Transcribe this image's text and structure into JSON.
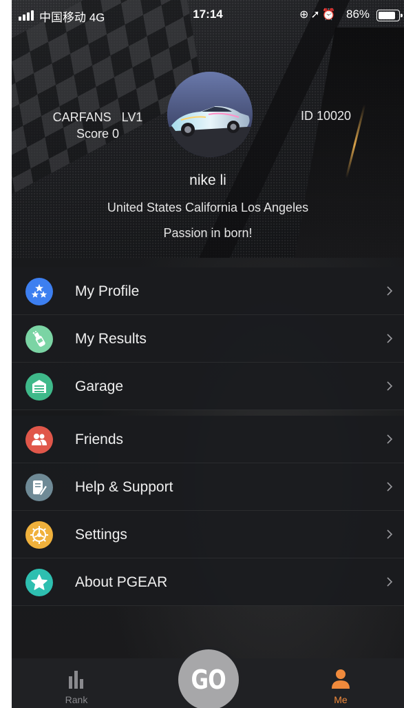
{
  "status_bar": {
    "carrier": "中国移动 4G",
    "time": "17:14",
    "battery_pct": "86%",
    "battery_level": 0.86,
    "icons": [
      "orientation-lock-icon",
      "location-arrow-icon",
      "alarm-icon"
    ]
  },
  "profile": {
    "level_text": "CARFANS   LV1",
    "score_text": "Score 0",
    "id_text": "ID 10020",
    "name": "nike li",
    "location": "United States California Los Angeles",
    "motto": "Passion in born!"
  },
  "menu": {
    "group1": [
      {
        "label": "My Profile",
        "icon": "stars-icon",
        "color": "#3d7ff0"
      },
      {
        "label": "My Results",
        "icon": "champagne-bottle-icon",
        "color": "#7bd4a4"
      },
      {
        "label": "Garage",
        "icon": "garage-door-icon",
        "color": "#3fb98a"
      }
    ],
    "group2": [
      {
        "label": "Friends",
        "icon": "friends-icon",
        "color": "#e0574a"
      },
      {
        "label": "Help & Support",
        "icon": "pen-note-icon",
        "color": "#6f8a96"
      },
      {
        "label": "Settings",
        "icon": "gear-icon",
        "color": "#f0b13c"
      },
      {
        "label": "About PGEAR",
        "icon": "star-icon",
        "color": "#2ebfb0"
      }
    ]
  },
  "tab_bar": {
    "rank_label": "Rank",
    "go_label": "GO",
    "me_label": "Me",
    "active_color": "#f08a3c",
    "inactive_color": "#8a8a8e"
  }
}
